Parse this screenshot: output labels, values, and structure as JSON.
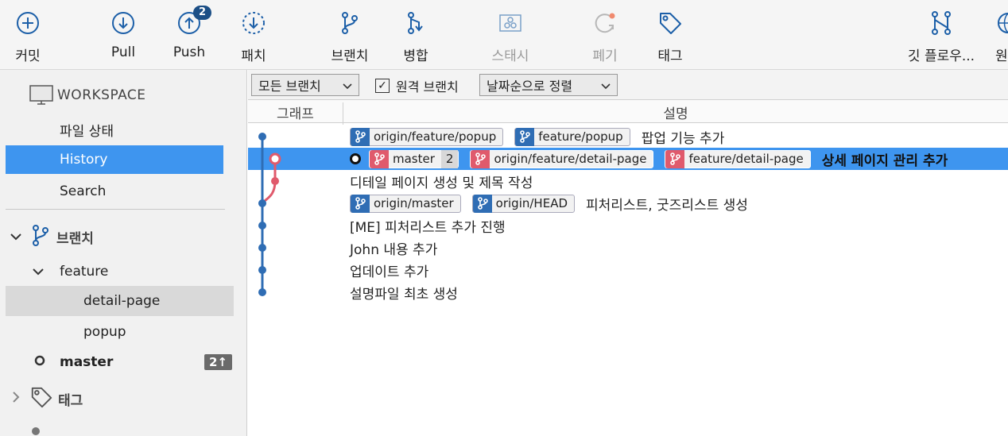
{
  "toolbar": {
    "commit": "커밋",
    "pull": "Pull",
    "push": "Push",
    "push_badge": "2",
    "patch": "패치",
    "branch": "브랜치",
    "merge": "병합",
    "stash": "스태시",
    "discard": "폐기",
    "tag": "태그",
    "gitflow": "깃 플로우...",
    "remote": "원"
  },
  "sidebar": {
    "workspace": "WORKSPACE",
    "file_status": "파일 상태",
    "history": "History",
    "search": "Search",
    "branches": "브랜치",
    "feature": "feature",
    "detail_page": "detail-page",
    "popup": "popup",
    "master": "master",
    "master_badge": "2↑",
    "tags": "태그"
  },
  "filters": {
    "all_branches": "모든 브랜치",
    "remote_branches": "원격 브랜치",
    "remote_checked": true,
    "sort": "날짜순으로 정렬"
  },
  "columns": {
    "graph": "그래프",
    "description": "설명"
  },
  "commits": [
    {
      "refs": [
        {
          "name": "origin/feature/popup",
          "color": "blue"
        },
        {
          "name": "feature/popup",
          "color": "blue"
        }
      ],
      "message": "팝업 기능 추가"
    },
    {
      "refs": [
        {
          "name": "master",
          "color": "red",
          "count": "2"
        },
        {
          "name": "origin/feature/detail-page",
          "color": "red"
        },
        {
          "name": "feature/detail-page",
          "color": "red"
        }
      ],
      "message": "상세 페이지 관리 추가",
      "selected": true,
      "head": true
    },
    {
      "refs": [],
      "message": "디테일 페이지 생성 및 제목 작성"
    },
    {
      "refs": [
        {
          "name": "origin/master",
          "color": "blue"
        },
        {
          "name": "origin/HEAD",
          "color": "blue"
        }
      ],
      "message": "피처리스트, 굿즈리스트 생성"
    },
    {
      "refs": [],
      "message": "[ME] 피처리스트 추가 진행"
    },
    {
      "refs": [],
      "message": "John 내용 추가"
    },
    {
      "refs": [],
      "message": "업데이트 추가"
    },
    {
      "refs": [],
      "message": "설명파일 최초 생성"
    }
  ],
  "colors": {
    "accent": "#3e95ef",
    "graph_blue": "#2f6db4",
    "graph_red": "#e05a6c",
    "badge": "#1c4f86"
  }
}
